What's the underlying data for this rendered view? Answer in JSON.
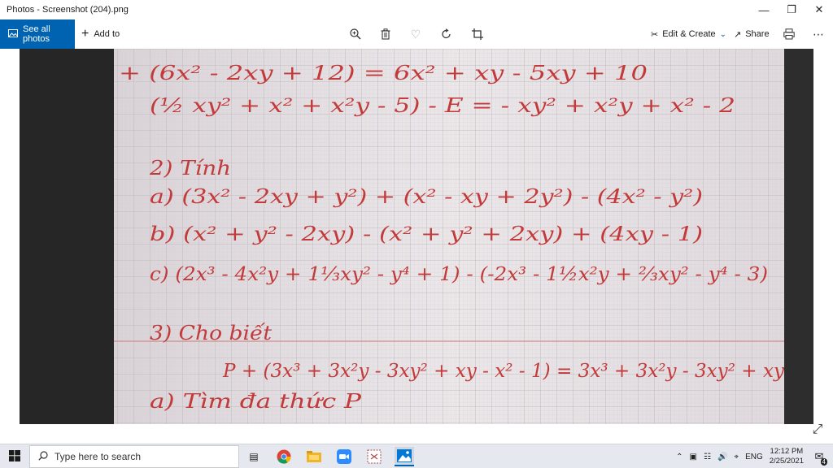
{
  "window": {
    "title": "Photos - Screenshot (204).png",
    "minimize_icon": "minimize-icon",
    "restore_icon": "restore-icon",
    "close_icon": "close-icon"
  },
  "toolbar": {
    "see_all_label": "See all photos",
    "add_to_label": "Add to",
    "edit_create_label": "Edit & Create",
    "share_label": "Share",
    "icons": [
      "zoom-icon",
      "delete-icon",
      "favorite-icon",
      "rotate-icon",
      "crop-icon",
      "print-icon",
      "more-icon"
    ]
  },
  "photo": {
    "lines": [
      "+ (6x² - 2xy + 12) = 6x² + xy - 5xy + 10",
      "(½ xy² + x² + x²y - 5) - E = - xy² + x²y + x² - 2",
      "2) Tính",
      "a) (3x² - 2xy + y²) + (x² - xy + 2y²) - (4x² - y²)",
      "b) (x² + y² - 2xy) - (x² + y² + 2xy) + (4xy - 1)",
      "c) (2x³ - 4x²y + 1⅓xy² - y⁴ + 1) - (-2x³ - 1½x²y + ⅔xy² - y⁴ - 3)",
      "3) Cho biết",
      "P + (3x³ + 3x²y - 3xy² + xy - x² - 1) = 3x³ + 3x²y - 3xy² + xy",
      "a) Tìm đa thức P"
    ],
    "ink_color": "#c23a3a",
    "paper_color": "#e9e4e6",
    "grid_color": "#b9b2b8"
  },
  "taskbar": {
    "search_placeholder": "Type here to search",
    "language": "ENG",
    "time": "12:12 PM",
    "date": "2/25/2021",
    "notifications_count": "4",
    "apps": [
      "task-view-icon",
      "chrome-icon",
      "file-explorer-icon",
      "zoom-app-icon",
      "snipping-icon",
      "photos-app-icon"
    ]
  }
}
